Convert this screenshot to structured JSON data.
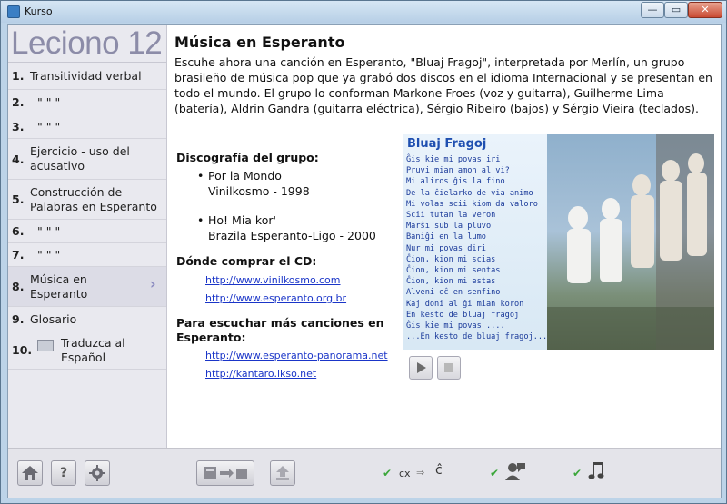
{
  "window": {
    "title": "Kurso",
    "min": "—",
    "max": "▭",
    "close": "✕"
  },
  "sidebar": {
    "lesson_title": "Leciono 12",
    "items": [
      {
        "num": "1.",
        "label": "Transitividad verbal"
      },
      {
        "num": "2.",
        "label": "\"   \"   \""
      },
      {
        "num": "3.",
        "label": "\"   \"   \""
      },
      {
        "num": "4.",
        "label": "Ejercicio - uso del acusativo"
      },
      {
        "num": "5.",
        "label": "Construcción de Palabras en Esperanto"
      },
      {
        "num": "6.",
        "label": "\"   \"   \""
      },
      {
        "num": "7.",
        "label": "\"   \"   \""
      },
      {
        "num": "8.",
        "label": "Música en Esperanto"
      },
      {
        "num": "9.",
        "label": "Glosario"
      },
      {
        "num": "10.",
        "label": "Traduzca al Español"
      }
    ]
  },
  "content": {
    "title": "Música en Esperanto",
    "intro": "Escuhe ahora una canción en Esperanto, \"Bluaj Fragoj\", interpretada por Merlín, un grupo brasileño de música pop que ya grabó dos discos en el idioma Internacional y se presentan en todo el mundo. El grupo lo conforman Markone Froes (voz y guitarra), Guilherme Lima (batería), Aldrin Gandra (guitarra eléctrica), Sérgio Ribeiro (bajos) y Sérgio Vieira (teclados).",
    "discography_heading": "Discografía del grupo:",
    "discography": [
      {
        "title": "Por la Mondo",
        "detail": "Vinilkosmo - 1998"
      },
      {
        "title": "Ho! Mia kor'",
        "detail": "Brazila Esperanto-Ligo - 2000"
      }
    ],
    "buy_heading": "Dónde comprar el CD:",
    "buy_links": [
      "http://www.vinilkosmo.com",
      "http://www.esperanto.org.br"
    ],
    "listen_heading": "Para escuchar más canciones en Esperanto:",
    "listen_links": [
      "http://www.esperanto-panorama.net",
      "http://kantaro.ikso.net"
    ],
    "album": {
      "title": "Bluaj Fragoj",
      "lyrics": [
        "Ĝis kie mi povas iri",
        "Pruvi mian amon al vi?",
        "Mi aliros ĝis la fino",
        "De la ĉielarko de via animo",
        "Mi volas scii kiom da valoro",
        "Scii tutan la veron",
        "Marŝi sub la pluvo",
        "Baniĝi en la lumo",
        "Nur mi povas diri",
        "Ĉion, kion mi scias",
        "Ĉion, kion mi sentas",
        "Ĉion, kion mi estas",
        "Alveni eĉ en senfino",
        "Kaj doni al ĝi mian koron",
        "En kesto de bluaj fragoj",
        "Ĝis kie mi povas ....",
        "...En kesto de bluaj fragoj..."
      ]
    }
  },
  "bottombar": {
    "cx_text": "cx",
    "arrow": "⇒",
    "chat_target": "ĉ"
  }
}
